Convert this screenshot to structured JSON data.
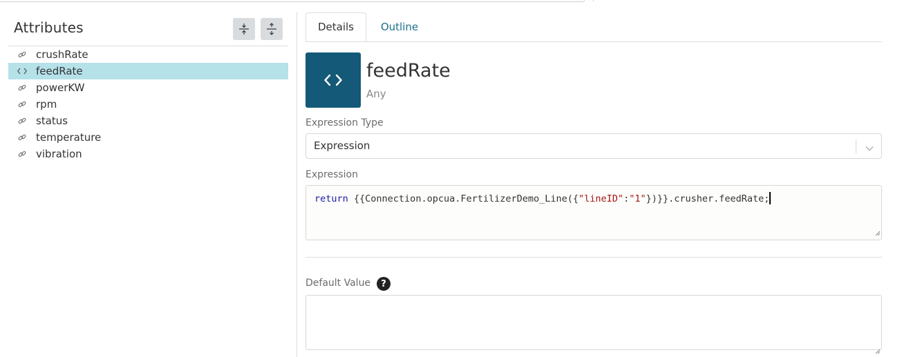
{
  "attributes_panel": {
    "title": "Attributes",
    "collapse_all_icon": "collapse-vertical-icon",
    "expand_all_icon": "expand-vertical-icon",
    "items": [
      {
        "label": "crushRate",
        "icon": "link-icon",
        "selected": false
      },
      {
        "label": "feedRate",
        "icon": "code-icon",
        "selected": true
      },
      {
        "label": "powerKW",
        "icon": "link-icon",
        "selected": false
      },
      {
        "label": "rpm",
        "icon": "link-icon",
        "selected": false
      },
      {
        "label": "status",
        "icon": "link-icon",
        "selected": false
      },
      {
        "label": "temperature",
        "icon": "link-icon",
        "selected": false
      },
      {
        "label": "vibration",
        "icon": "link-icon",
        "selected": false
      }
    ]
  },
  "tabs": [
    {
      "label": "Details",
      "active": true
    },
    {
      "label": "Outline",
      "active": false
    }
  ],
  "detail": {
    "icon": "code-icon",
    "name": "feedRate",
    "type": "Any",
    "expression_type_label": "Expression Type",
    "expression_type_value": "Expression",
    "expression_label": "Expression",
    "expression": {
      "keyword": "return",
      "prefix": " {{Connection.opcua.FertilizerDemo_Line({",
      "key": "\"lineID\"",
      "colon": ":",
      "value": "\"1\"",
      "suffix": "})}}.crusher.feedRate;"
    },
    "default_value_label": "Default Value",
    "help_icon_glyph": "?",
    "default_value": ""
  },
  "colors": {
    "selected_row": "#b5e1e9",
    "icon_tile": "#145977",
    "tab_link": "#1e6e8c",
    "tool_button": "#d8dcdf"
  }
}
